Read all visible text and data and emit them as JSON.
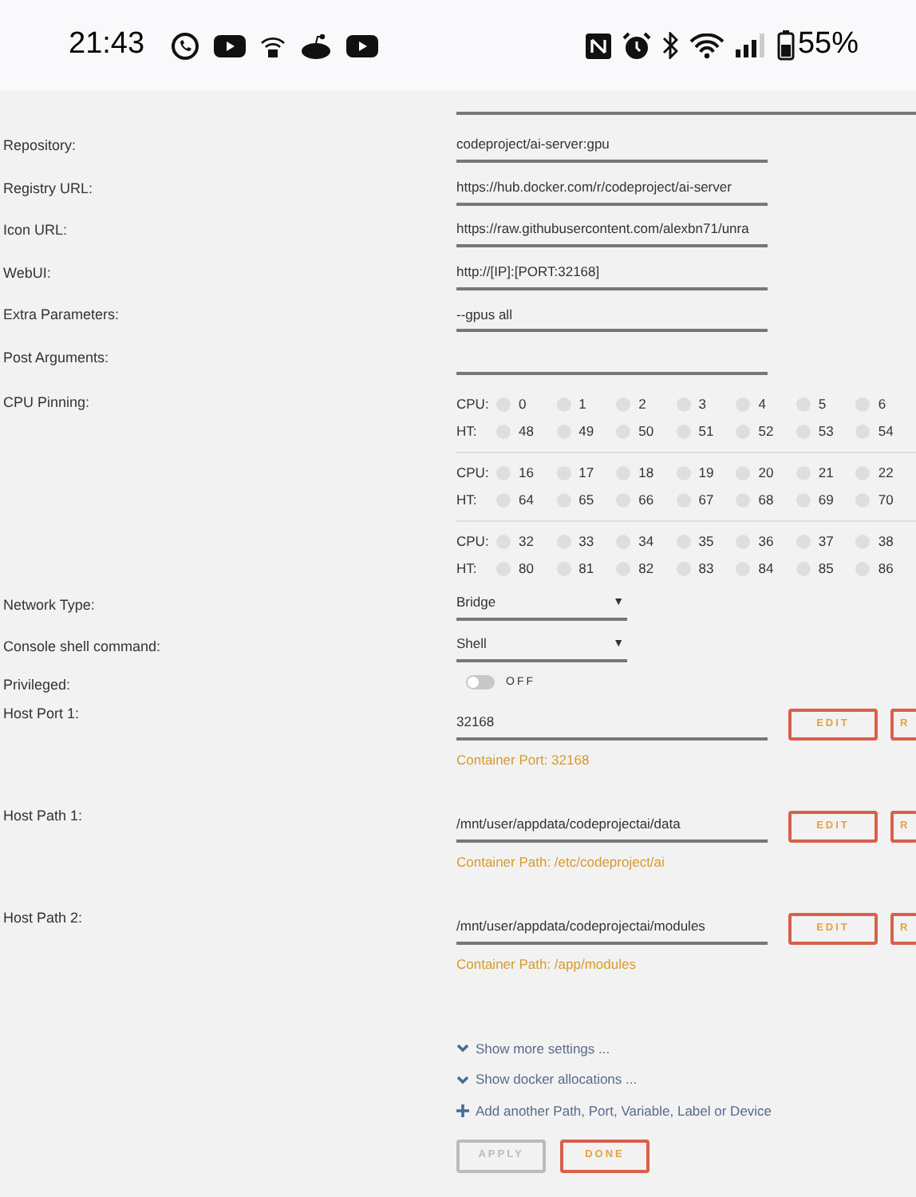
{
  "status_bar": {
    "time": "21:43",
    "battery": "55%"
  },
  "settings": [
    {
      "kind": "text",
      "label": "Repository:",
      "value": "codeproject/ai-server:gpu"
    },
    {
      "kind": "text",
      "label": "Registry URL:",
      "value": "https://hub.docker.com/r/codeproject/ai-server"
    },
    {
      "kind": "text",
      "label": "Icon URL:",
      "value": "https://raw.githubusercontent.com/alexbn71/unra"
    },
    {
      "kind": "text",
      "label": "WebUI:",
      "value": "http://[IP]:[PORT:32168]"
    },
    {
      "kind": "text",
      "label": "Extra Parameters:",
      "value": "--gpus all"
    },
    {
      "kind": "text",
      "label": "Post Arguments:"
    },
    {
      "kind": "cpu",
      "label": "CPU Pinning:",
      "groups": [
        {
          "rows": [
            {
              "label": "CPU:",
              "cores": [
                {
                  "number": "0",
                  "checked": false
                },
                {
                  "number": "1",
                  "checked": false
                },
                {
                  "number": "2",
                  "checked": false
                },
                {
                  "number": "3",
                  "checked": false
                },
                {
                  "number": "4",
                  "checked": false
                },
                {
                  "number": "5",
                  "checked": false
                },
                {
                  "number": "6",
                  "checked": false
                }
              ]
            },
            {
              "label": "HT:",
              "cores": [
                {
                  "number": "48",
                  "checked": false
                },
                {
                  "number": "49",
                  "checked": false
                },
                {
                  "number": "50",
                  "checked": false
                },
                {
                  "number": "51",
                  "checked": false
                },
                {
                  "number": "52",
                  "checked": false
                },
                {
                  "number": "53",
                  "checked": false
                },
                {
                  "number": "54",
                  "checked": false
                }
              ]
            }
          ]
        },
        {
          "rows": [
            {
              "label": "CPU:",
              "cores": [
                {
                  "number": "16",
                  "checked": false
                },
                {
                  "number": "17",
                  "checked": false
                },
                {
                  "number": "18",
                  "checked": false
                },
                {
                  "number": "19",
                  "checked": false
                },
                {
                  "number": "20",
                  "checked": false
                },
                {
                  "number": "21",
                  "checked": false
                },
                {
                  "number": "22",
                  "checked": false
                }
              ]
            },
            {
              "label": "HT:",
              "cores": [
                {
                  "number": "64",
                  "checked": false
                },
                {
                  "number": "65",
                  "checked": false
                },
                {
                  "number": "66",
                  "checked": false
                },
                {
                  "number": "67",
                  "checked": false
                },
                {
                  "number": "68",
                  "checked": false
                },
                {
                  "number": "69",
                  "checked": false
                },
                {
                  "number": "70",
                  "checked": false
                }
              ]
            }
          ]
        },
        {
          "rows": [
            {
              "label": "CPU:",
              "cores": [
                {
                  "number": "32",
                  "checked": false
                },
                {
                  "number": "33",
                  "checked": false
                },
                {
                  "number": "34",
                  "checked": false
                },
                {
                  "number": "35",
                  "checked": false
                },
                {
                  "number": "36",
                  "checked": false
                },
                {
                  "number": "37",
                  "checked": false
                },
                {
                  "number": "38",
                  "checked": false
                }
              ]
            },
            {
              "label": "HT:",
              "cores": [
                {
                  "number": "80",
                  "checked": false
                },
                {
                  "number": "81",
                  "checked": false
                },
                {
                  "number": "82",
                  "checked": false
                },
                {
                  "number": "83",
                  "checked": false
                },
                {
                  "number": "84",
                  "checked": false
                },
                {
                  "number": "85",
                  "checked": false
                },
                {
                  "number": "86",
                  "checked": false
                }
              ]
            }
          ]
        }
      ]
    },
    {
      "kind": "select",
      "label": "Network Type:",
      "value": "Bridge",
      "arrow": "▼"
    },
    {
      "kind": "select",
      "label": "Console shell command:",
      "value": "Shell",
      "arrow": "▼"
    },
    {
      "kind": "toggle",
      "label": "Privileged:",
      "on": false,
      "state": "OFF"
    },
    {
      "kind": "mapping",
      "label": "Host Port 1:",
      "value": "32168",
      "hint": "Container Port: 32168",
      "buttons": [
        "EDIT",
        "R"
      ]
    },
    {
      "kind": "mapping",
      "label": "Host Path 1:",
      "value": "/mnt/user/appdata/codeprojectai/data",
      "hint": "Container Path: /etc/codeproject/ai",
      "buttons": [
        "EDIT",
        "R"
      ]
    },
    {
      "kind": "mapping",
      "label": "Host Path 2:",
      "value": "/mnt/user/appdata/codeprojectai/modules",
      "hint": "Container Path: /app/modules",
      "buttons": [
        "EDIT",
        "R"
      ]
    }
  ],
  "links": [
    {
      "kind": "expand",
      "text": "Show more settings ..."
    },
    {
      "kind": "expand",
      "text": "Show docker allocations ..."
    },
    {
      "kind": "add",
      "text": "Add another Path, Port, Variable, Label or Device"
    }
  ],
  "actions": [
    {
      "label": "APPLY",
      "disabled": true
    },
    {
      "label": "DONE",
      "disabled": false
    }
  ]
}
